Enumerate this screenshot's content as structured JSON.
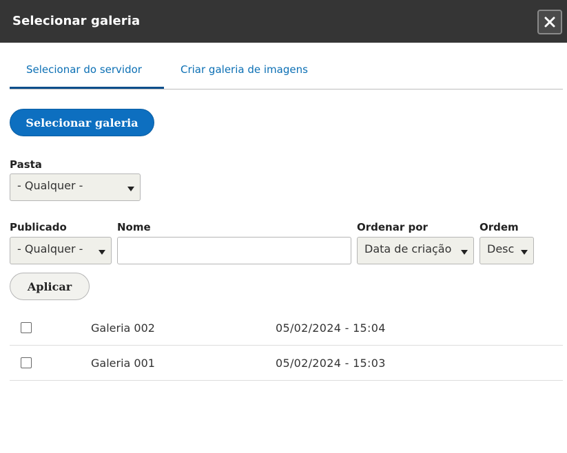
{
  "dialog": {
    "title": "Selecionar galeria",
    "close_icon": "close-icon"
  },
  "tabs": [
    {
      "label": "Selecionar do servidor",
      "active": true
    },
    {
      "label": "Criar galeria de imagens",
      "active": false
    }
  ],
  "select_button": {
    "label": "Selecionar galeria"
  },
  "filters": {
    "folder": {
      "label": "Pasta",
      "value": "- Qualquer -"
    },
    "published": {
      "label": "Publicado",
      "value": "- Qualquer -"
    },
    "name": {
      "label": "Nome",
      "value": ""
    },
    "sort_by": {
      "label": "Ordenar por",
      "value": "Data de criação"
    },
    "order": {
      "label": "Ordem",
      "value": "Desc"
    }
  },
  "apply_button": {
    "label": "Aplicar"
  },
  "rows": [
    {
      "name": "Galeria 002",
      "date": "05/02/2024 - 15:04",
      "checked": false
    },
    {
      "name": "Galeria 001",
      "date": "05/02/2024 - 15:03",
      "checked": false
    }
  ],
  "colors": {
    "titlebar": "#353535",
    "accent": "#0d6fc0",
    "tab_text": "#0b6fb4"
  }
}
